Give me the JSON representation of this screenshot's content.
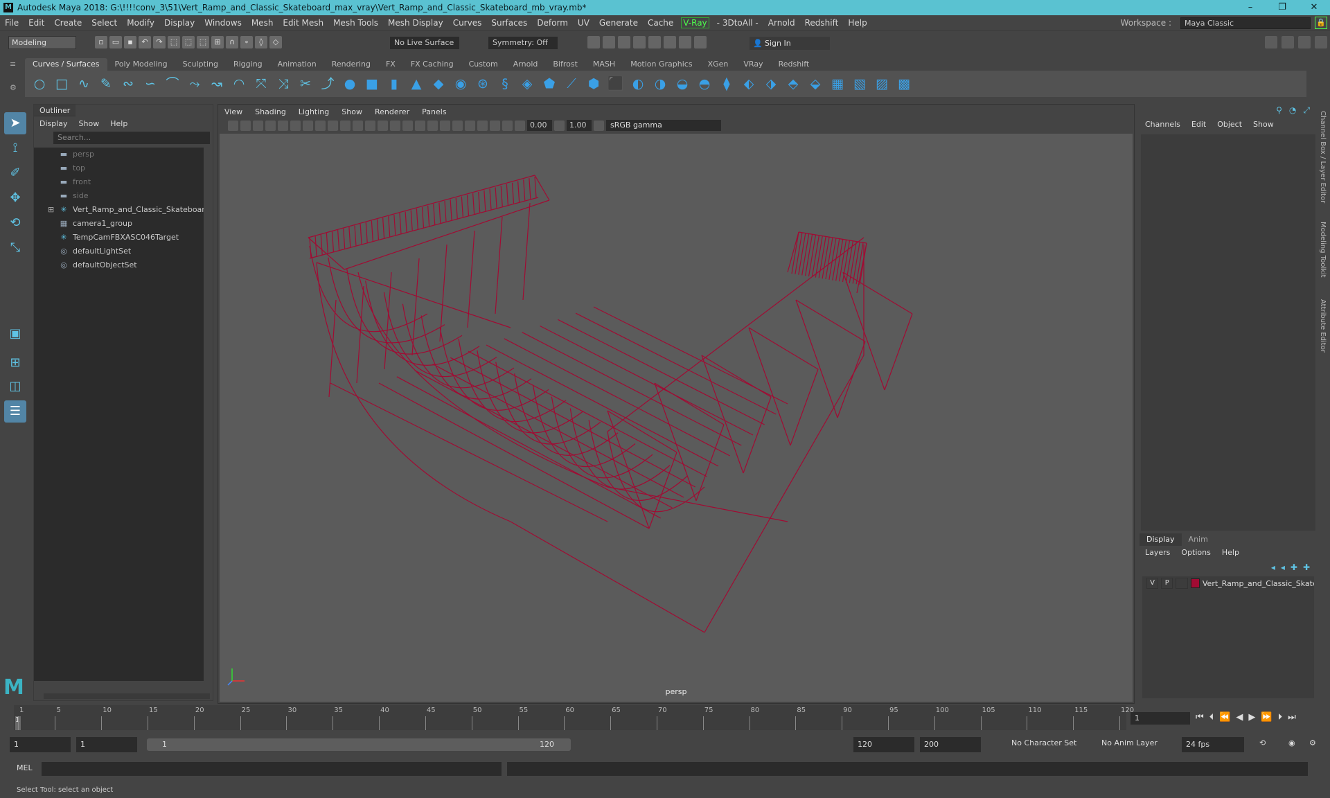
{
  "title": "Autodesk Maya 2018: G:\\!!!!conv_3\\51\\Vert_Ramp_and_Classic_Skateboard_max_vray\\Vert_Ramp_and_Classic_Skateboard_mb_vray.mb*",
  "menu": [
    "File",
    "Edit",
    "Create",
    "Select",
    "Modify",
    "Display",
    "Windows",
    "Mesh",
    "Edit Mesh",
    "Mesh Tools",
    "Mesh Display",
    "Curves",
    "Surfaces",
    "Deform",
    "UV",
    "Generate",
    "Cache"
  ],
  "menu_vray": "V-Ray",
  "menu_after": [
    "- 3DtoAll -",
    "Arnold",
    "Redshift",
    "Help"
  ],
  "workspace_label": "Workspace :",
  "workspace_value": "Maya Classic",
  "mode": "Modeling",
  "live_surface": "No Live Surface",
  "symmetry": "Symmetry: Off",
  "sign_in": "Sign In",
  "shelf_tabs": [
    "Curves / Surfaces",
    "Poly Modeling",
    "Sculpting",
    "Rigging",
    "Animation",
    "Rendering",
    "FX",
    "FX Caching",
    "Custom",
    "Arnold",
    "Bifrost",
    "MASH",
    "Motion Graphics",
    "XGen",
    "VRay",
    "Redshift"
  ],
  "outliner": {
    "title": "Outliner",
    "menus": [
      "Display",
      "Show",
      "Help"
    ],
    "search_placeholder": "Search...",
    "items": [
      {
        "label": "persp",
        "dim": true
      },
      {
        "label": "top",
        "dim": true
      },
      {
        "label": "front",
        "dim": true
      },
      {
        "label": "side",
        "dim": true
      },
      {
        "label": "Vert_Ramp_and_Classic_Skateboard_r",
        "dim": false
      },
      {
        "label": "camera1_group",
        "dim": false
      },
      {
        "label": "TempCamFBXASC046Target",
        "dim": false
      },
      {
        "label": "defaultLightSet",
        "dim": false
      },
      {
        "label": "defaultObjectSet",
        "dim": false
      }
    ]
  },
  "viewport": {
    "menus": [
      "View",
      "Shading",
      "Lighting",
      "Show",
      "Renderer",
      "Panels"
    ],
    "value1": "0.00",
    "value2": "1.00",
    "color_space": "sRGB gamma",
    "camera_label": "persp",
    "wire_color": "#a10b33"
  },
  "channelbox": {
    "menus": [
      "Channels",
      "Edit",
      "Object",
      "Show"
    ]
  },
  "side_tabs": [
    "Channel Box / Layer Editor",
    "Modeling Toolkit",
    "Attribute Editor"
  ],
  "layers": {
    "tabs": [
      "Display",
      "Anim"
    ],
    "menus": [
      "Layers",
      "Options",
      "Help"
    ],
    "row": {
      "v": "V",
      "p": "P",
      "name": "Vert_Ramp_and_Classic_Skatel",
      "color": "#a10b33"
    }
  },
  "timeline": {
    "ticks": [
      "1",
      "5",
      "10",
      "15",
      "20",
      "25",
      "30",
      "35",
      "40",
      "45",
      "50",
      "55",
      "60",
      "65",
      "70",
      "75",
      "80",
      "85",
      "90",
      "95",
      "100",
      "105",
      "110",
      "115",
      "120"
    ],
    "current_frame": "1"
  },
  "range": {
    "start": "1",
    "start2": "1",
    "bar_start": "1",
    "bar_end": "120",
    "end": "120",
    "end2": "200",
    "character_set": "No Character Set",
    "anim_layer": "No Anim Layer",
    "fps": "24 fps"
  },
  "mel_label": "MEL",
  "help_text": "Select Tool: select an object"
}
